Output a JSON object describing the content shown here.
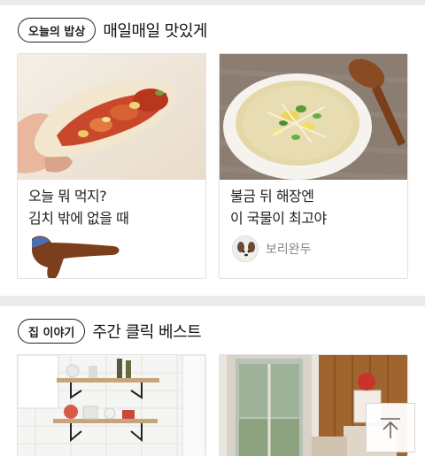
{
  "section1": {
    "tag": "오늘의 밥상",
    "title": "매일매일 맛있게",
    "cards": [
      {
        "title_lines": [
          "오늘 뭐 먹지?",
          "김치 밖에 없을 때"
        ],
        "author": ""
      },
      {
        "title_lines": [
          "불금 뒤 해장엔",
          "이 국물이 최고야"
        ],
        "author": "보리완두"
      }
    ]
  },
  "section2": {
    "tag": "집 이야기",
    "title": "주간 클릭 베스트"
  },
  "icons": {
    "scroll_top": "arrow-up-icon"
  }
}
